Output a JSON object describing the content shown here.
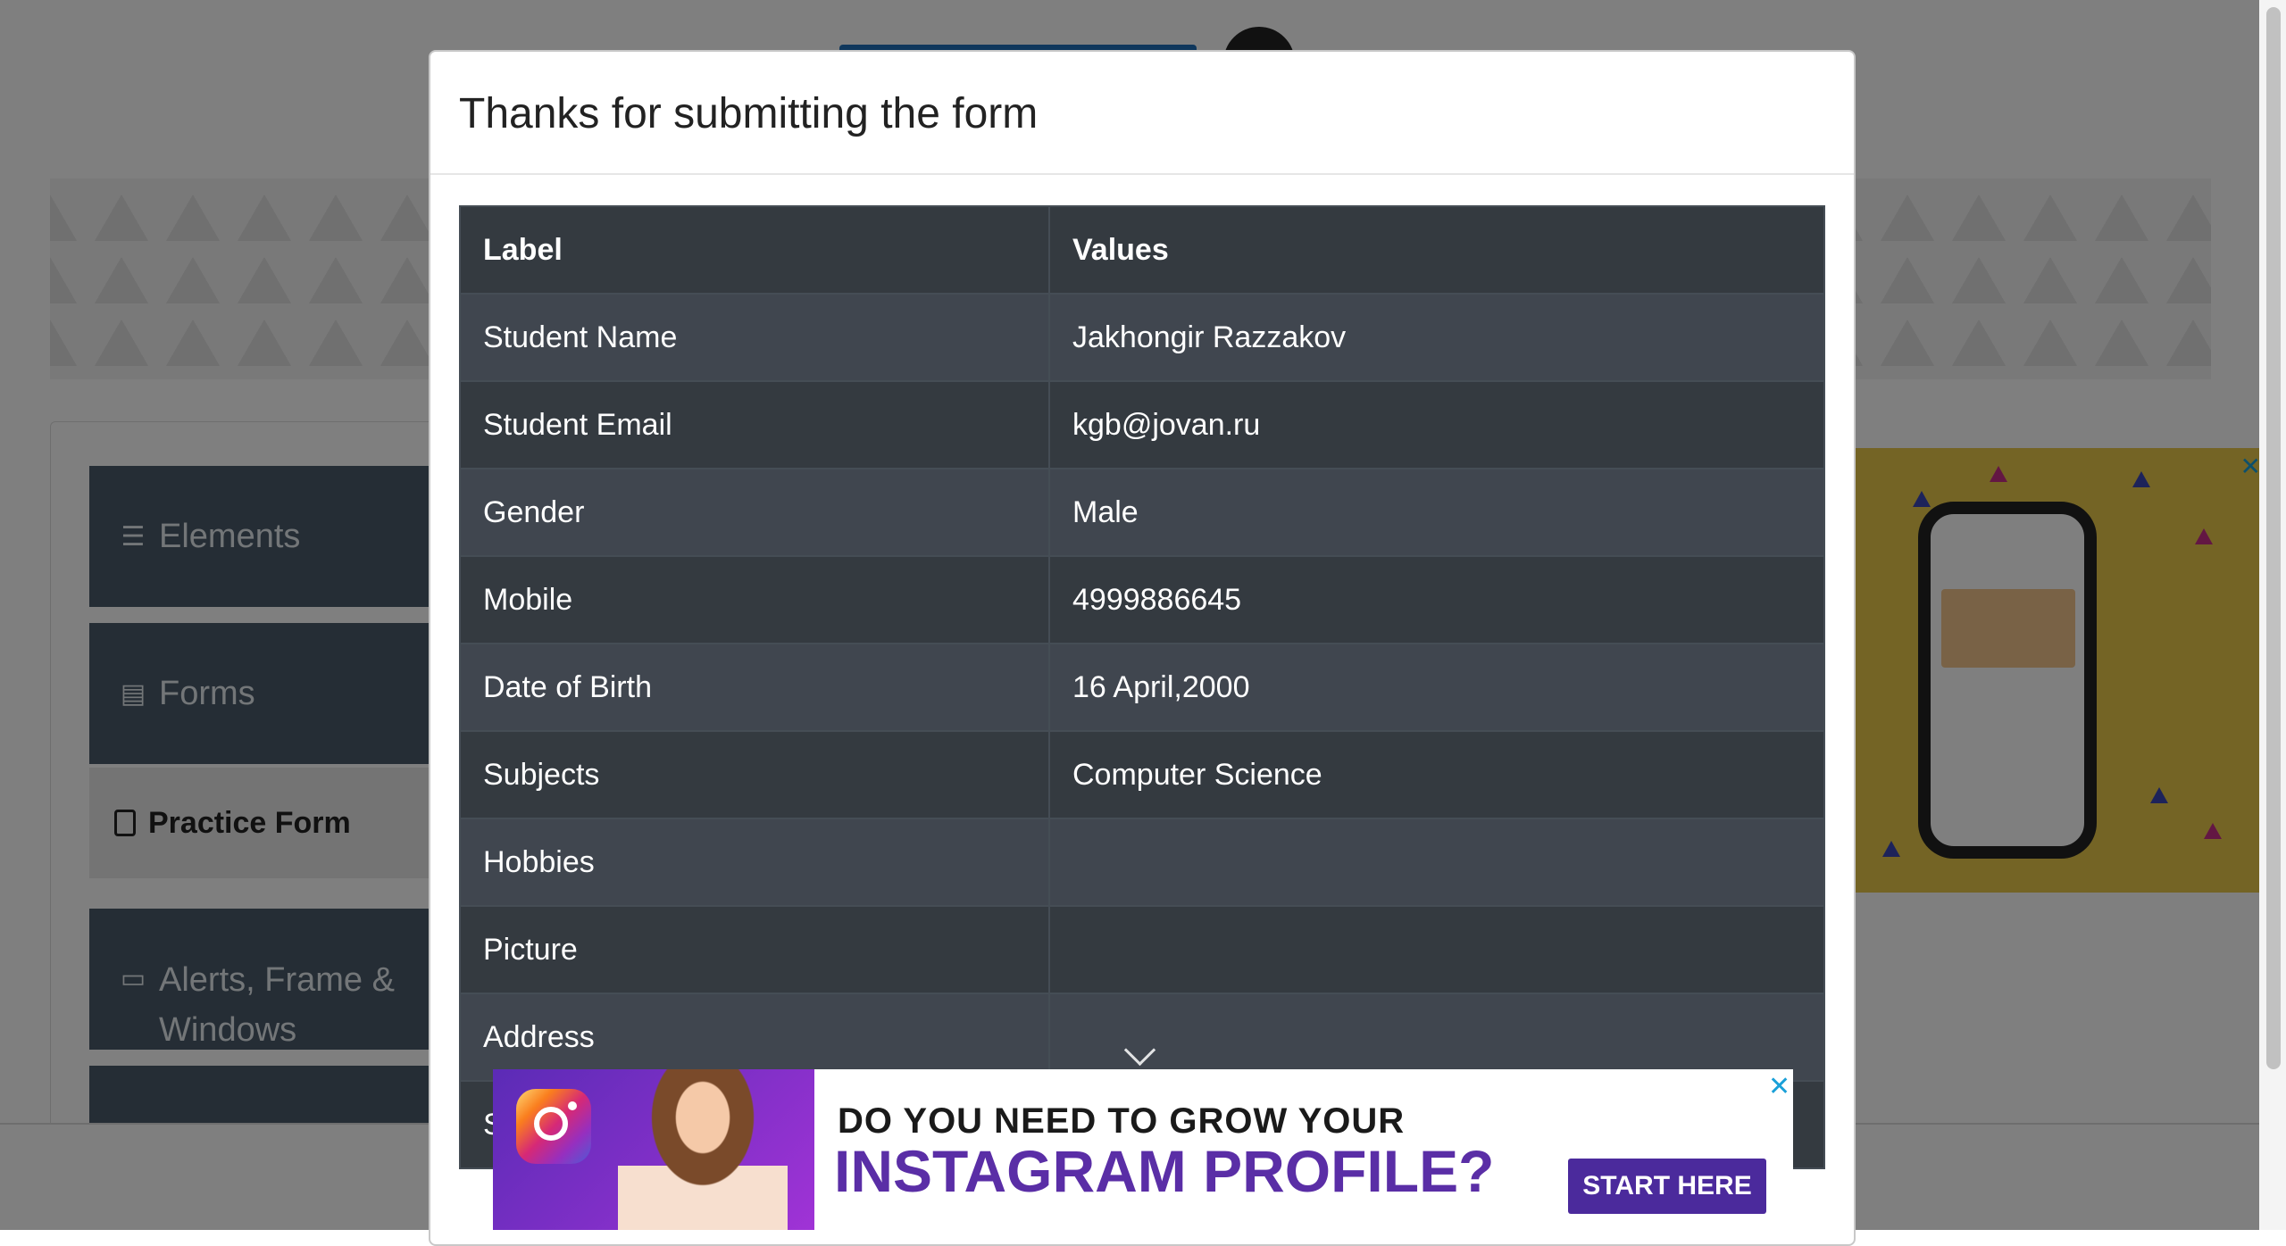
{
  "sidebar": {
    "groups": [
      {
        "label": "Elements",
        "icon": "hamburger-icon"
      },
      {
        "label": "Forms",
        "icon": "document-icon"
      },
      {
        "label": "Alerts, Frame & Windows",
        "icon": "window-icon"
      }
    ],
    "active_item": {
      "label": "Practice Form",
      "icon": "badge-icon"
    }
  },
  "modal": {
    "title": "Thanks for submitting the form",
    "table": {
      "headers": [
        "Label",
        "Values"
      ],
      "rows": [
        {
          "label": "Student Name",
          "value": "Jakhongir Razzakov"
        },
        {
          "label": "Student Email",
          "value": "kgb@jovan.ru"
        },
        {
          "label": "Gender",
          "value": "Male"
        },
        {
          "label": "Mobile",
          "value": "4999886645"
        },
        {
          "label": "Date of Birth",
          "value": "16 April,2000"
        },
        {
          "label": "Subjects",
          "value": "Computer Science"
        },
        {
          "label": "Hobbies",
          "value": ""
        },
        {
          "label": "Picture",
          "value": ""
        },
        {
          "label": "Address",
          "value": ""
        },
        {
          "label": "S",
          "value": ""
        }
      ]
    }
  },
  "bottom_ad": {
    "line1": "DO YOU NEED TO GROW YOUR",
    "line2": "INSTAGRAM PROFILE?",
    "cta": "START HERE",
    "close": "✕"
  },
  "right_ad": {
    "close": "✕"
  },
  "colors": {
    "table_header": "#343a40",
    "table_row_alt": "#40464f",
    "ad_accent": "#4b2a9c"
  }
}
